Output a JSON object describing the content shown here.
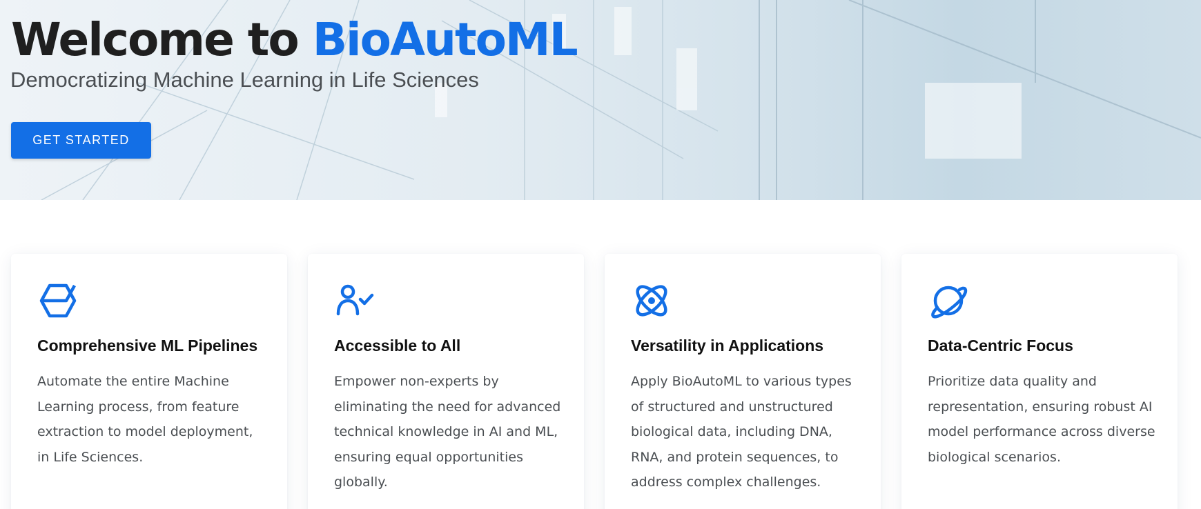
{
  "hero": {
    "title_prefix": "Welcome to ",
    "title_brand": "BioAutoML",
    "subtitle": "Democratizing Machine Learning in Life Sciences",
    "cta_label": "GET STARTED"
  },
  "features": [
    {
      "icon": "hexagon-cube-icon",
      "title": "Comprehensive ML Pipelines",
      "text": "Automate the entire Machine Learning process, from feature extraction to model deployment, in Life Sciences."
    },
    {
      "icon": "person-check-icon",
      "title": "Accessible to All",
      "text": "Empower non-experts by eliminating the need for advanced technical knowledge in AI and ML, ensuring equal opportunities globally."
    },
    {
      "icon": "atom-icon",
      "title": "Versatility in Applications",
      "text": "Apply BioAutoML to various types of structured and unstructured biological data, including DNA, RNA, and protein sequences, to address complex challenges."
    },
    {
      "icon": "planet-icon",
      "title": "Data-Centric Focus",
      "text": "Prioritize data quality and representation, ensuring robust AI model performance across diverse biological scenarios."
    }
  ],
  "colors": {
    "accent": "#136fe6",
    "heading": "#1f1f1f",
    "body_text": "#4a4e52"
  }
}
